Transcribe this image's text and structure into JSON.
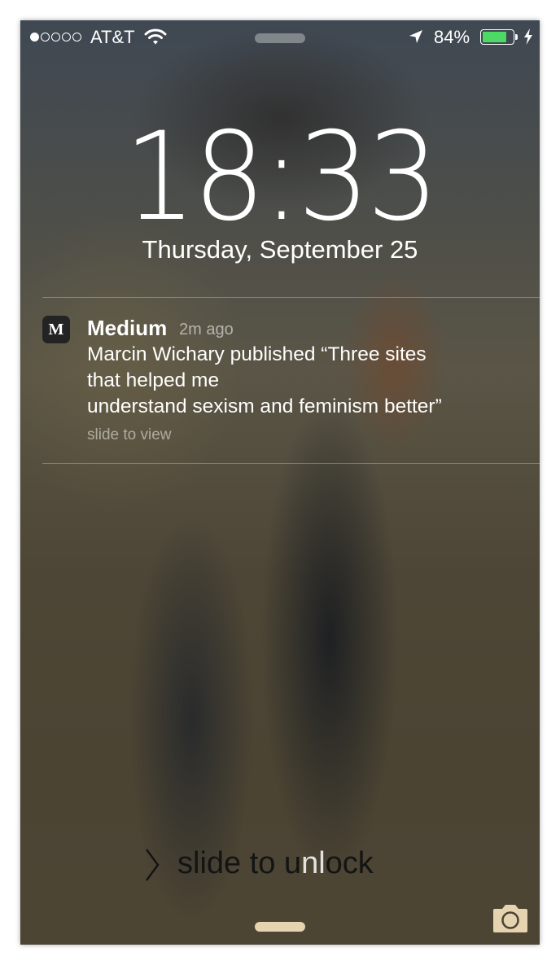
{
  "status_bar": {
    "signal_bars_filled": 1,
    "signal_bars_total": 5,
    "carrier": "AT&T",
    "battery_percent": "84%",
    "battery_level": 0.84,
    "battery_color": "#4cd964"
  },
  "lock_screen": {
    "time": "18:33",
    "date": "Thursday, September 25"
  },
  "notification": {
    "app_icon_letter": "M",
    "app_name": "Medium",
    "time_ago": "2m ago",
    "message": "Marcin Wichary published “Three sites\nthat helped me\nunderstand sexism and feminism better”",
    "hint": "slide to view"
  },
  "unlock": {
    "label_dark": "slide to u",
    "label_shine": "nl",
    "label_rest": "ock"
  },
  "icons": [
    "wifi-icon",
    "location-arrow-icon",
    "battery-icon",
    "charging-bolt-icon",
    "chevron-right-icon",
    "camera-icon"
  ]
}
